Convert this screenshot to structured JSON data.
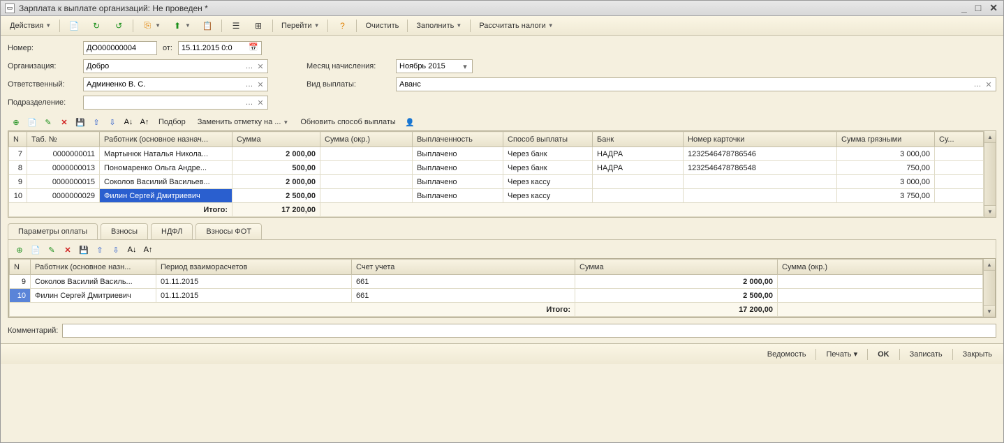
{
  "title": "Зарплата к выплате организаций: Не проведен *",
  "toolbar": {
    "actions": "Действия",
    "go": "Перейти",
    "clear": "Очистить",
    "fill": "Заполнить",
    "calc_taxes": "Рассчитать налоги"
  },
  "form": {
    "number_label": "Номер:",
    "number": "ДО000000004",
    "date_label": "от:",
    "date": "15.11.2015  0:0",
    "org_label": "Организация:",
    "org": "Добро",
    "month_label": "Месяц начисления:",
    "month": "Ноябрь 2015",
    "responsible_label": "Ответственный:",
    "responsible": "Админенко В. С.",
    "payment_type_label": "Вид выплаты:",
    "payment_type": "Аванс",
    "subdivision_label": "Подразделение:",
    "subdivision": ""
  },
  "table_toolbar": {
    "selection": "Подбор",
    "replace_mark": "Заменить отметку на ...",
    "update_method": "Обновить способ выплаты"
  },
  "main_table": {
    "headers": {
      "n": "N",
      "tab_no": "Таб. №",
      "worker": "Работник (основное назнач...",
      "sum": "Сумма",
      "sum_okr": "Сумма (окр.)",
      "paid": "Выплаченность",
      "method": "Способ выплаты",
      "bank": "Банк",
      "card": "Номер карточки",
      "sum_gross": "Сумма грязными",
      "su": "Су..."
    },
    "rows": [
      {
        "n": "7",
        "tab": "0000000011",
        "worker": "Мартынюк Наталья Никола...",
        "sum": "2 000,00",
        "sum_okr": "",
        "paid": "Выплачено",
        "method": "Через банк",
        "bank": "НАДРА",
        "card": "1232546478786546",
        "gross": "3 000,00"
      },
      {
        "n": "8",
        "tab": "0000000013",
        "worker": "Пономаренко Ольга Андре...",
        "sum": "500,00",
        "sum_okr": "",
        "paid": "Выплачено",
        "method": "Через банк",
        "bank": "НАДРА",
        "card": "1232546478786548",
        "gross": "750,00"
      },
      {
        "n": "9",
        "tab": "0000000015",
        "worker": "Соколов Василий Васильев...",
        "sum": "2 000,00",
        "sum_okr": "",
        "paid": "Выплачено",
        "method": "Через кассу",
        "bank": "",
        "card": "",
        "gross": "3 000,00"
      },
      {
        "n": "10",
        "tab": "0000000029",
        "worker": "Филин Сергей Дмитриевич",
        "sum": "2 500,00",
        "sum_okr": "",
        "paid": "Выплачено",
        "method": "Через кассу",
        "bank": "",
        "card": "",
        "gross": "3 750,00"
      }
    ],
    "total_label": "Итого:",
    "total_sum": "17 200,00"
  },
  "tabs": {
    "t1": "Параметры оплаты",
    "t2": "Взносы",
    "t3": "НДФЛ",
    "t4": "Взносы ФОТ"
  },
  "sub_table": {
    "headers": {
      "n": "N",
      "worker": "Работник (основное назн...",
      "period": "Период взаиморасчетов",
      "account": "Счет учета",
      "sum": "Сумма",
      "sum_okr": "Сумма (окр.)"
    },
    "rows": [
      {
        "n": "9",
        "worker": "Соколов Василий Василь...",
        "period": "01.11.2015",
        "account": "661",
        "sum": "2 000,00",
        "sum_okr": ""
      },
      {
        "n": "10",
        "worker": "Филин Сергей Дмитриевич",
        "period": "01.11.2015",
        "account": "661",
        "sum": "2 500,00",
        "sum_okr": ""
      }
    ],
    "total_label": "Итого:",
    "total_sum": "17 200,00"
  },
  "comment_label": "Комментарий:",
  "comment": "",
  "footer": {
    "sheet": "Ведомость",
    "print": "Печать",
    "ok": "OK",
    "save": "Записать",
    "close": "Закрыть"
  }
}
